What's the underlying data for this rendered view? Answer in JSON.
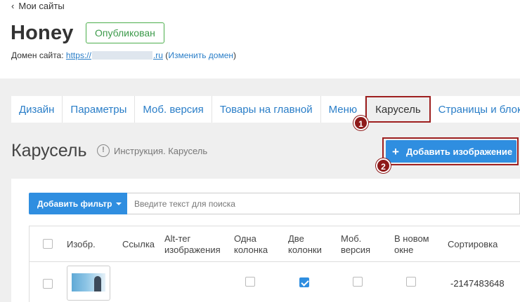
{
  "nav": {
    "back_label": "Мои сайты",
    "back_icon": "chevron-left-icon"
  },
  "site": {
    "title": "Honey",
    "status": "Опубликован",
    "domain_label": "Домен сайта:",
    "domain_prefix": "https://",
    "domain_suffix": ".ru",
    "change_domain": "Изменить домен"
  },
  "tabs": [
    {
      "label": "Дизайн",
      "active": false
    },
    {
      "label": "Параметры",
      "active": false
    },
    {
      "label": "Моб. версия",
      "active": false
    },
    {
      "label": "Товары на главной",
      "active": false
    },
    {
      "label": "Меню",
      "active": false
    },
    {
      "label": "Карусель",
      "active": true
    },
    {
      "label": "Страницы и блоки",
      "active": false
    }
  ],
  "steps": [
    "1",
    "2"
  ],
  "section": {
    "title": "Карусель",
    "instruction": "Инструкция. Карусель",
    "add_image": "Добавить изображение"
  },
  "filter": {
    "button": "Добавить фильтр",
    "search_placeholder": "Введите текст для поиска"
  },
  "table": {
    "columns": [
      "Изобр.",
      "Ссылка",
      "Alt-тег изображения",
      "Одна колонка",
      "Две колонки",
      "Моб. версия",
      "В новом окне",
      "Сортировка"
    ],
    "rows": [
      {
        "selected": false,
        "link": "",
        "alt": "",
        "one_column": false,
        "two_columns": true,
        "mobile": false,
        "new_window": false,
        "sort": "-2147483648"
      }
    ]
  },
  "colors": {
    "accent": "#2f8ee0",
    "highlight": "#9e1f1f",
    "published": "#3c9a4a"
  }
}
